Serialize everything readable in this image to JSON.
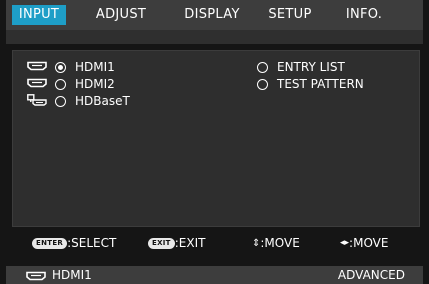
{
  "tabs": [
    {
      "label": "INPUT"
    },
    {
      "label": "ADJUST"
    },
    {
      "label": "DISPLAY"
    },
    {
      "label": "SETUP"
    },
    {
      "label": "INFO."
    }
  ],
  "inputs": [
    {
      "label": "HDMI1",
      "selected": true,
      "icon": "hdmi-icon"
    },
    {
      "label": "HDMI2",
      "selected": false,
      "icon": "hdmi-icon"
    },
    {
      "label": "HDBaseT",
      "selected": false,
      "icon": "hdbaset-icon"
    }
  ],
  "options": [
    {
      "label": "ENTRY LIST"
    },
    {
      "label": "TEST PATTERN"
    }
  ],
  "footer": {
    "enter_key": "ENTER",
    "select": ":SELECT",
    "exit_key": "EXIT",
    "exit": ":EXIT",
    "move_vertical": ":MOVE",
    "move_horizontal": ":MOVE"
  },
  "status": {
    "source": "HDMI1",
    "mode": "ADVANCED"
  },
  "colors": {
    "accent": "#1e9ec7",
    "panel": "#2e2e2e",
    "tab_bar": "#3d3d3d"
  }
}
